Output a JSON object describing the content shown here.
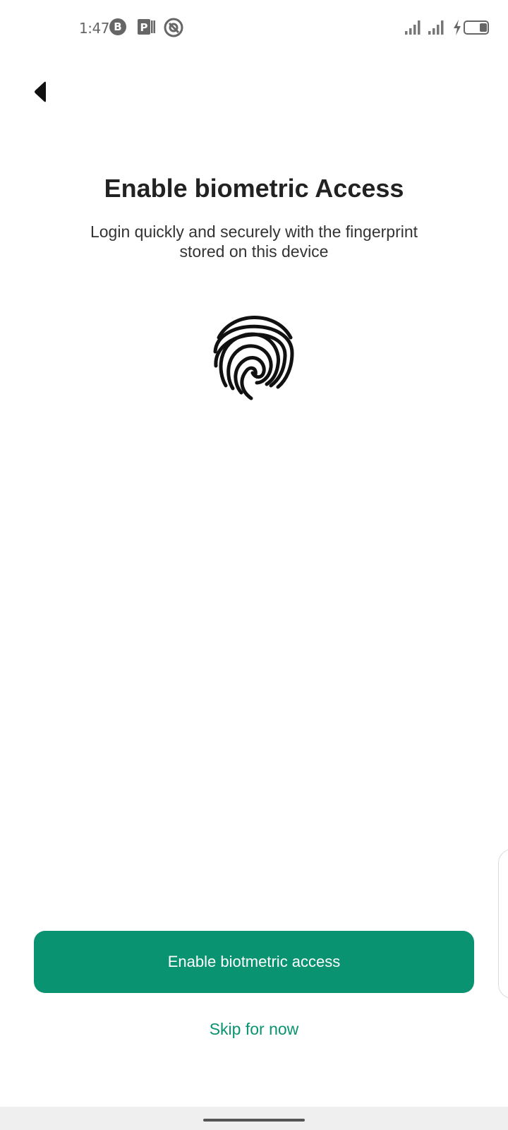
{
  "status_bar": {
    "time": "1:47",
    "icons_left": [
      "b-badge-icon",
      "parking-icon",
      "app-q-icon"
    ],
    "icons_right": [
      "signal-1-icon",
      "signal-2-icon",
      "charging-icon",
      "battery-icon"
    ]
  },
  "header": {
    "back_icon": "back-arrow-icon"
  },
  "main": {
    "title": "Enable biometric Access",
    "subtitle": "Login quickly and securely with the fingerprint stored on this device",
    "illustration_icon": "fingerprint-icon"
  },
  "actions": {
    "primary_label": "Enable biotmetric access",
    "secondary_label": "Skip for now"
  },
  "colors": {
    "accent": "#0a9370",
    "text": "#222222",
    "background": "#ffffff"
  }
}
